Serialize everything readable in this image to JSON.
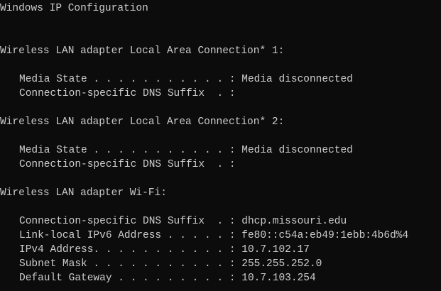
{
  "console": {
    "title_line": "Windows IP Configuration",
    "adapters": [
      {
        "header": "Wireless LAN adapter Local Area Connection* 1:",
        "rows": [
          "Media State . . . . . . . . . . . : Media disconnected",
          "Connection-specific DNS Suffix  . :"
        ]
      },
      {
        "header": "Wireless LAN adapter Local Area Connection* 2:",
        "rows": [
          "Media State . . . . . . . . . . . : Media disconnected",
          "Connection-specific DNS Suffix  . :"
        ]
      },
      {
        "header": "Wireless LAN adapter Wi-Fi:",
        "rows": [
          "Connection-specific DNS Suffix  . : dhcp.missouri.edu",
          "Link-local IPv6 Address . . . . . : fe80::c54a:eb49:1ebb:4b6d%4",
          "IPv4 Address. . . . . . . . . . . : 10.7.102.17",
          "Subnet Mask . . . . . . . . . . . : 255.255.252.0",
          "Default Gateway . . . . . . . . . : 10.7.103.254"
        ]
      }
    ]
  },
  "colors": {
    "background": "#0c0c0c",
    "text": "#cccccc"
  }
}
